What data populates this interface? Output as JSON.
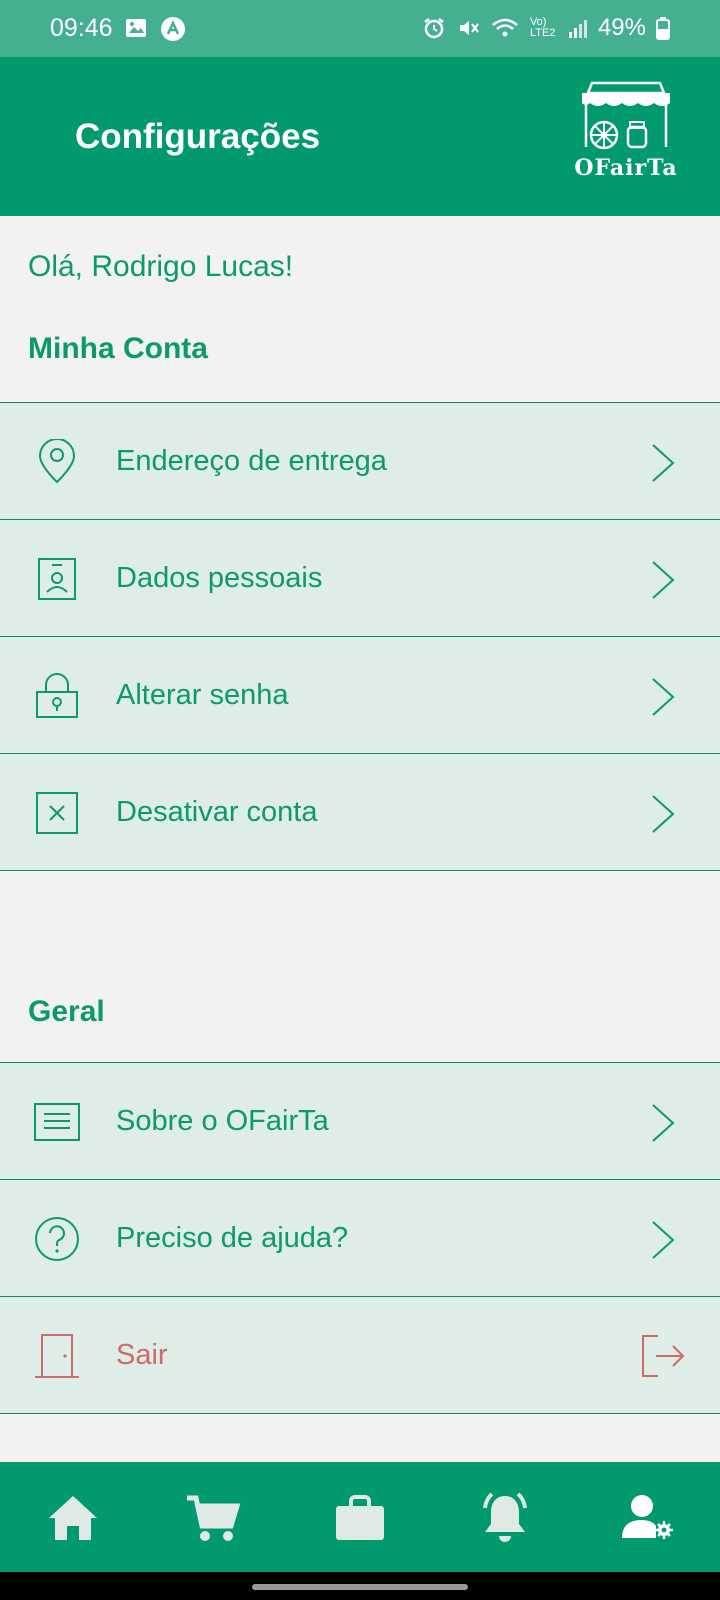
{
  "status_bar": {
    "time": "09:46",
    "battery": "49%",
    "network": "Vo) LTE2",
    "icons": [
      "gallery-icon",
      "app-notification-icon",
      "alarm-icon",
      "mute-icon",
      "wifi-icon",
      "signal-icon",
      "battery-icon"
    ]
  },
  "header": {
    "title": "Configurações",
    "logo_text": "OFairTa"
  },
  "greeting": "Olá, Rodrigo Lucas!",
  "sections": {
    "account": {
      "title": "Minha Conta",
      "items": [
        {
          "label": "Endereço de entrega",
          "icon": "location-pin-icon"
        },
        {
          "label": "Dados pessoais",
          "icon": "id-badge-icon"
        },
        {
          "label": "Alterar senha",
          "icon": "lock-icon"
        },
        {
          "label": "Desativar conta",
          "icon": "x-box-icon"
        }
      ]
    },
    "general": {
      "title": "Geral",
      "items": [
        {
          "label": "Sobre o OFairTa",
          "icon": "document-icon"
        },
        {
          "label": "Preciso de ajuda?",
          "icon": "help-circle-icon"
        },
        {
          "label": "Sair",
          "icon": "door-icon"
        }
      ]
    }
  },
  "bottom_nav": [
    "home-icon",
    "cart-icon",
    "bag-icon",
    "bell-icon",
    "user-settings-icon"
  ],
  "colors": {
    "primary": "#009a6e",
    "status_bar": "#45b08f",
    "row_bg": "#deede6",
    "text_green": "#0c9a6d",
    "logout_red": "#cd6b6b",
    "page_bg": "#f2f2f2"
  }
}
